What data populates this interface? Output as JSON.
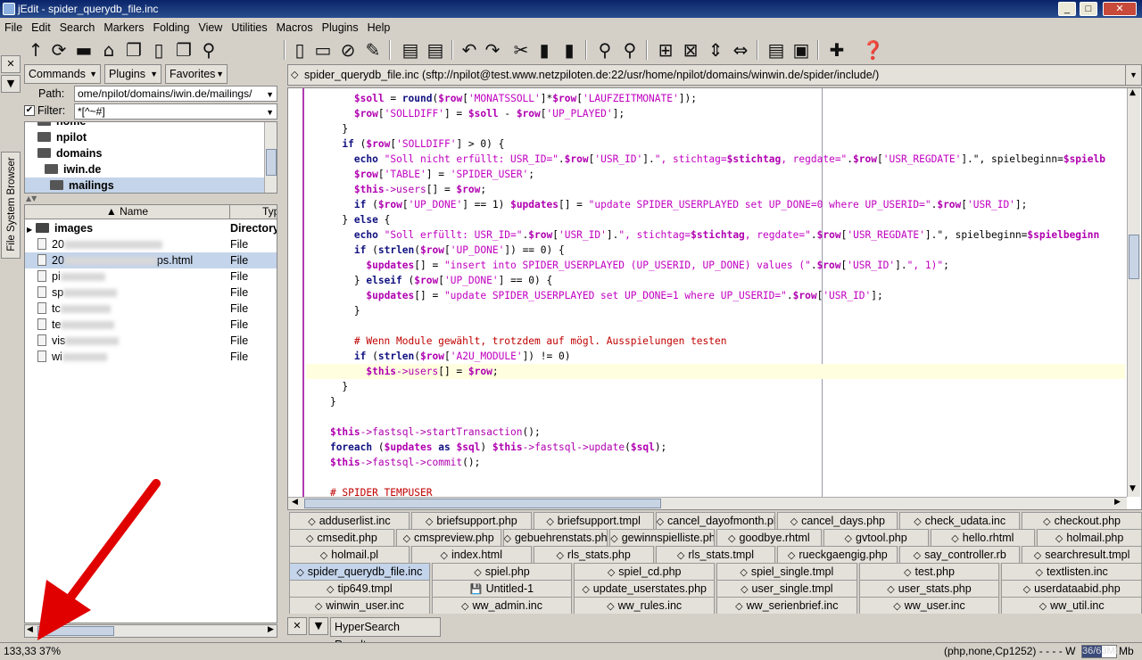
{
  "window": {
    "title": "jEdit - spider_querydb_file.inc"
  },
  "menu": [
    "File",
    "Edit",
    "Search",
    "Markers",
    "Folding",
    "View",
    "Utilities",
    "Macros",
    "Plugins",
    "Help"
  ],
  "browser": {
    "tab_label": "File System Browser",
    "buttons": {
      "commands": "Commands",
      "plugins": "Plugins",
      "favorites": "Favorites"
    },
    "path_label": "Path:",
    "path_value": "ome/npilot/domains/iwin.de/mailings/",
    "filter_label": "Filter:",
    "filter_value": "*[^~#]",
    "tree": [
      "home",
      "npilot",
      "domains",
      "iwin.de",
      "mailings"
    ],
    "list_headers": {
      "name": "Name",
      "type": "Typ"
    },
    "files": [
      {
        "name": "images",
        "type": "Directory"
      },
      {
        "name": "20",
        "type": "File"
      },
      {
        "name": "20",
        "suffix": "ps.html",
        "type": "File"
      },
      {
        "name": "pi",
        "type": "File"
      },
      {
        "name": "sp",
        "type": "File"
      },
      {
        "name": "tc",
        "type": "File"
      },
      {
        "name": "te",
        "type": "File"
      },
      {
        "name": "vis",
        "type": "File"
      },
      {
        "name": "wi",
        "type": "File"
      }
    ]
  },
  "editor": {
    "buffer_path": "spider_querydb_file.inc (sftp://npilot@test.www.netzpiloten.de:22/usr/home/npilot/domains/winwin.de/spider/include/)",
    "lines": [
      "        $soll = round($row['MONATSSOLL']*$row['LAUFZEITMONATE']);",
      "        $row['SOLLDIFF'] = $soll - $row['UP_PLAYED'];",
      "      }",
      "      if ($row['SOLLDIFF'] > 0) {",
      "        echo \"Soll nicht erfüllt: USR_ID=\".$row['USR_ID'].\", stichtag=$stichtag, regdate=\".$row['USR_REGDATE'].\", spielbeginn=$spielb",
      "        $row['TABLE'] = 'SPIDER_USER';",
      "        $this->users[] = $row;",
      "        if ($row['UP_DONE'] == 1) $updates[] = \"update SPIDER_USERPLAYED set UP_DONE=0 where UP_USERID=\".$row['USR_ID'];",
      "      } else {",
      "        echo \"Soll erfüllt: USR_ID=\".$row['USR_ID'].\", stichtag=$stichtag, regdate=\".$row['USR_REGDATE'].\", spielbeginn=$spielbeginn",
      "        if (strlen($row['UP_DONE']) == 0) {",
      "          $updates[] = \"insert into SPIDER_USERPLAYED (UP_USERID, UP_DONE) values (\".$row['USR_ID'].\", 1)\";",
      "        } elseif ($row['UP_DONE'] == 0) {",
      "          $updates[] = \"update SPIDER_USERPLAYED set UP_DONE=1 where UP_USERID=\".$row['USR_ID'];",
      "        }",
      "",
      "        # Wenn Module gewählt, trotzdem auf mögl. Ausspielungen testen",
      "        if (strlen($row['A2U_MODULE']) != 0)",
      "          $this->users[] = $row;",
      "      }",
      "    }",
      "",
      "    $this->fastsql->startTransaction();",
      "    foreach ($updates as $sql) $this->fastsql->update($sql);",
      "    $this->fastsql->commit();",
      "",
      "    # SPIDER_TEMPUSER"
    ]
  },
  "tabs": [
    [
      "adduserlist.inc",
      "briefsupport.php",
      "briefsupport.tmpl",
      "cancel_dayofmonth.php",
      "cancel_days.php",
      "check_udata.inc",
      "checkout.php"
    ],
    [
      "cmsedit.php",
      "cmspreview.php",
      "gebuehrenstats.php",
      "gewinnspielliste.php",
      "goodbye.rhtml",
      "gvtool.php",
      "hello.rhtml",
      "holmail.php"
    ],
    [
      "holmail.pl",
      "index.html",
      "rls_stats.php",
      "rls_stats.tmpl",
      "rueckgaengig.php",
      "say_controller.rb",
      "searchresult.tmpl"
    ],
    [
      "spider_querydb_file.inc",
      "spiel.php",
      "spiel_cd.php",
      "spiel_single.tmpl",
      "test.php",
      "textlisten.inc"
    ],
    [
      "tip649.tmpl",
      "Untitled-1",
      "update_userstates.php",
      "user_single.tmpl",
      "user_stats.php",
      "userdataabid.php"
    ],
    [
      "winwin_user.inc",
      "ww_admin.inc",
      "ww_rules.inc",
      "ww_serienbrief.inc",
      "ww_user.inc",
      "ww_util.inc"
    ]
  ],
  "bottom": {
    "hypersearch_label": "HyperSearch Results"
  },
  "status": {
    "position": "133,33 37%",
    "mode": "(php,none,Cp1252) - - - - W",
    "memory": "36/63Mb",
    "memory_fraction": 0.57
  }
}
